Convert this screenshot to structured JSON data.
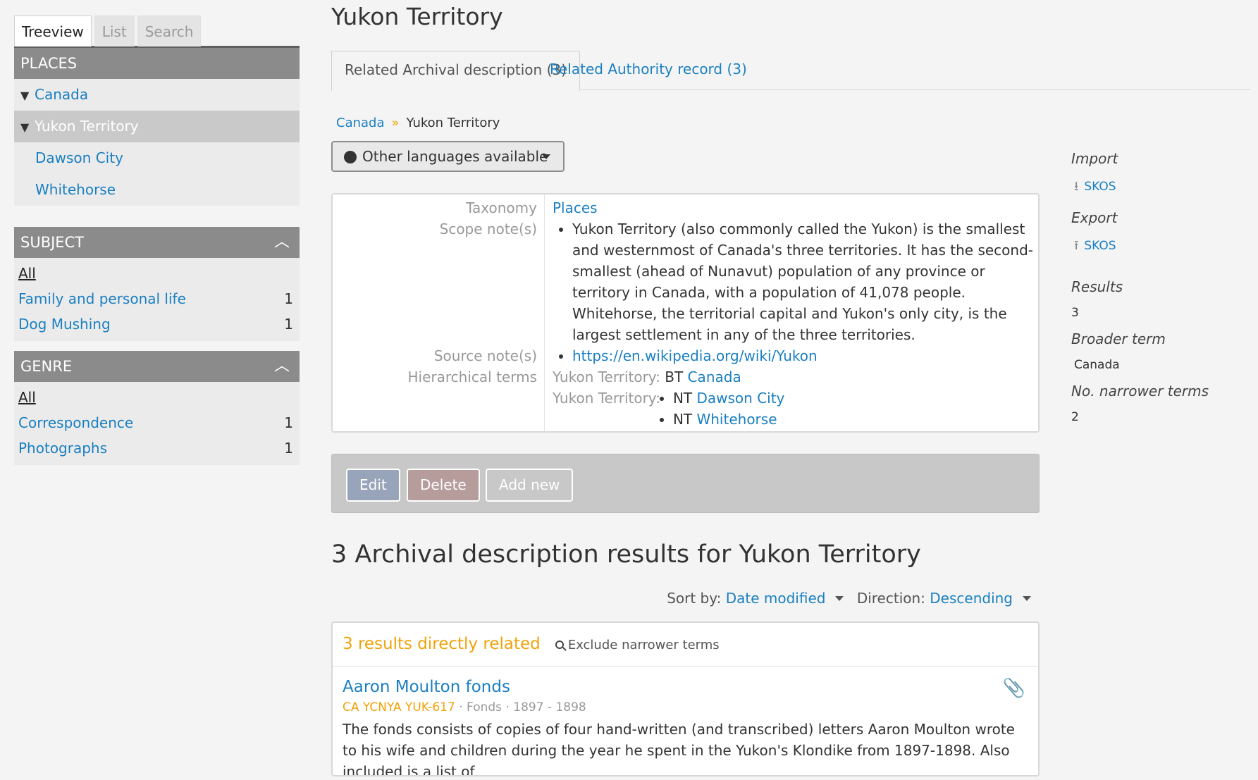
{
  "sidebar": {
    "tabs": [
      "Treeview",
      "List",
      "Search"
    ],
    "places_header": "PLACES",
    "tree": [
      {
        "label": "Canada"
      },
      {
        "label": "Yukon Territory"
      },
      {
        "label": "Dawson City"
      },
      {
        "label": "Whitehorse"
      }
    ],
    "subject": {
      "header": "SUBJECT",
      "all": "All",
      "items": [
        {
          "label": "Family and personal life",
          "count": "1"
        },
        {
          "label": "Dog Mushing",
          "count": "1"
        }
      ]
    },
    "genre": {
      "header": "GENRE",
      "all": "All",
      "items": [
        {
          "label": "Correspondence",
          "count": "1"
        },
        {
          "label": "Photographs",
          "count": "1"
        }
      ]
    }
  },
  "main": {
    "title": "Yukon Territory",
    "tabs": [
      "Related Archival description (3)",
      "Related Authority record (3)"
    ],
    "breadcrumb": [
      "Canada",
      "Yukon Territory"
    ],
    "lang_button": "Other languages available",
    "fields": {
      "taxonomy_label": "Taxonomy",
      "taxonomy_value": "Places",
      "scope_label": "Scope note(s)",
      "scope_value": "Yukon Territory (also commonly called the Yukon) is the smallest and westernmost of Canada's three territories. It has the second-smallest (ahead of Nunavut) population of any province or territory in Canada, with a population of 41,078 people. Whitehorse, the territorial capital and Yukon's only city, is the largest settlement in any of the three territories.",
      "source_label": "Source note(s)",
      "source_value": "https://en.wikipedia.org/wiki/Yukon",
      "hier_label": "Hierarchical terms",
      "hier_prefix": "Yukon Territory:",
      "bt": "BT",
      "bt_term": "Canada",
      "nt": "NT",
      "nt_terms": [
        "Dawson City",
        "Whitehorse"
      ]
    },
    "actions": {
      "edit": "Edit",
      "delete": "Delete",
      "add_new": "Add new"
    },
    "results_title": "3 Archival description results for Yukon Territory",
    "sort": {
      "label": "Sort by:",
      "value": "Date modified",
      "dir_label": "Direction:",
      "dir_value": "Descending"
    },
    "results": {
      "count_text": "3 results directly related",
      "exclude_text": "Exclude narrower terms",
      "items": [
        {
          "title": "Aaron Moulton fonds",
          "ref": "CA YCNYA YUK-617",
          "level": "Fonds",
          "dates": "1897 - 1898",
          "excerpt": "The fonds consists of copies of four hand-written (and transcribed) letters Aaron Moulton wrote to his wife and children during the year he spent in the Yukon's Klondike from 1897-1898. Also included is a list of"
        }
      ]
    }
  },
  "context": {
    "import_label": "Import",
    "import_link": "SKOS",
    "export_label": "Export",
    "export_link": "SKOS",
    "results_label": "Results",
    "results_value": "3",
    "broader_label": "Broader term",
    "broader_value": "Canada",
    "narrower_label": "No. narrower terms",
    "narrower_value": "2"
  }
}
